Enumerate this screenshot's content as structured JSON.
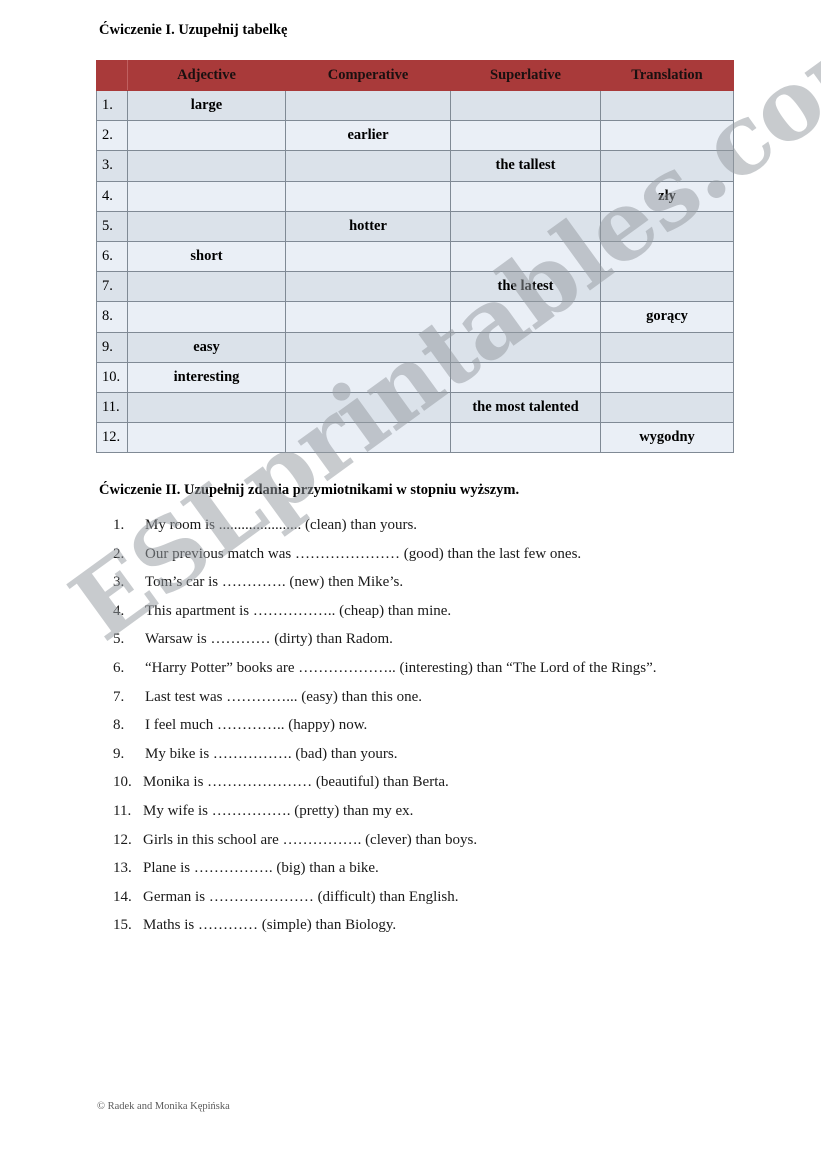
{
  "document": {
    "exercise_1_heading": "Ćwiczenie I. Uzupełnij tabelkę",
    "exercise_2_heading": "Ćwiczenie II. Uzupełnij zdania przymiotnikami w stopniu wyższym.",
    "footer_credit": "© Radek and Monika Kępińska"
  },
  "watermark": {
    "text": "ESLprintables.com",
    "color": "#969ba2"
  },
  "colors": {
    "header_background": "#A93A3A",
    "row_odd_background": "#DBE2EA",
    "row_even_background": "#EAEFF6",
    "cell_border": "#808a95"
  },
  "table": {
    "columns": [
      "",
      "Adjective",
      "Comperative",
      "Superlative",
      "Translation"
    ],
    "rows": [
      {
        "num": "1.",
        "adjective": "large",
        "comparative": "",
        "superlative": "",
        "translation": ""
      },
      {
        "num": "2.",
        "adjective": "",
        "comparative": "earlier",
        "superlative": "",
        "translation": ""
      },
      {
        "num": "3.",
        "adjective": "",
        "comparative": "",
        "superlative": "the tallest",
        "translation": ""
      },
      {
        "num": "4.",
        "adjective": "",
        "comparative": "",
        "superlative": "",
        "translation": "zły"
      },
      {
        "num": "5.",
        "adjective": "",
        "comparative": "hotter",
        "superlative": "",
        "translation": ""
      },
      {
        "num": "6.",
        "adjective": "short",
        "comparative": "",
        "superlative": "",
        "translation": ""
      },
      {
        "num": "7.",
        "adjective": "",
        "comparative": "",
        "superlative": "the latest",
        "translation": ""
      },
      {
        "num": "8.",
        "adjective": "",
        "comparative": "",
        "superlative": "",
        "translation": "gorący"
      },
      {
        "num": "9.",
        "adjective": "easy",
        "comparative": "",
        "superlative": "",
        "translation": ""
      },
      {
        "num": "10.",
        "adjective": "interesting",
        "comparative": "",
        "superlative": "",
        "translation": ""
      },
      {
        "num": "11.",
        "adjective": "",
        "comparative": "",
        "superlative": "the most talented",
        "translation": ""
      },
      {
        "num": "12.",
        "adjective": "",
        "comparative": "",
        "superlative": "",
        "translation": "wygodny"
      }
    ]
  },
  "exercise_2": {
    "items": [
      {
        "num": "1.",
        "text": "My room is ...................... (clean) than yours."
      },
      {
        "num": "2.",
        "text": "Our previous match was ………………… (good) than the last few ones."
      },
      {
        "num": "3.",
        "text": "Tom’s car is …………. (new) then Mike’s."
      },
      {
        "num": "4.",
        "text": "This apartment is …………….. (cheap) than mine."
      },
      {
        "num": "5.",
        "text": "Warsaw is ………… (dirty) than Radom."
      },
      {
        "num": "6.",
        "text": "“Harry Potter” books are ……………….. (interesting) than “The Lord of the Rings”."
      },
      {
        "num": "7.",
        "text": "Last test was …………... (easy) than this one."
      },
      {
        "num": "8.",
        "text": "I feel much ………….. (happy) now."
      },
      {
        "num": "9.",
        "text": "My bike is ……………. (bad) than yours."
      },
      {
        "num": "10.",
        "text": "Monika is ………………… (beautiful) than Berta."
      },
      {
        "num": "11.",
        "text": "My wife is ……………. (pretty) than my ex."
      },
      {
        "num": "12.",
        "text": "Girls in this school are ……………. (clever) than boys."
      },
      {
        "num": "13.",
        "text": "Plane is ……………. (big) than a bike."
      },
      {
        "num": "14.",
        "text": "German is ………………… (difficult) than English."
      },
      {
        "num": "15.",
        "text": "Maths is ………… (simple) than Biology."
      }
    ]
  }
}
